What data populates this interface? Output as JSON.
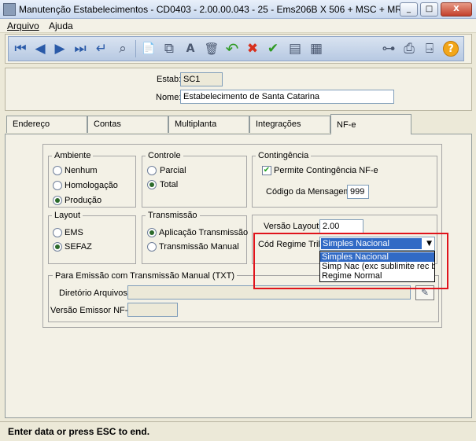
{
  "window": {
    "title": "Manutenção Estabelecimentos - CD0403 - 2.00.00.043 - 25 - Ems206B X 506 + MSC + MRI +",
    "minimize": "_",
    "maximize": "□",
    "close": "X"
  },
  "menu": {
    "arquivo": "Arquivo",
    "ajuda": "Ajuda"
  },
  "toolbar": {
    "first": "⏮",
    "prev": "◀",
    "next": "▶",
    "last": "⏭",
    "goto": "↵",
    "search": "⌕",
    "new": "📄",
    "copy": "⧉",
    "edit": "A",
    "delete": "🗑",
    "undo": "↶",
    "cancel": "✖",
    "save": "✔",
    "list": "▤",
    "report": "▦",
    "tree": "⊶",
    "print": "⎙",
    "exit": "⍈",
    "help": "?"
  },
  "header": {
    "estab_label": "Estab:",
    "estab_value": "SC1",
    "nome_label": "Nome:",
    "nome_value": "Estabelecimento de Santa Catarina"
  },
  "tabs": [
    "Endereço",
    "Contas",
    "Multiplanta",
    "Integrações",
    "NF-e"
  ],
  "ambiente": {
    "title": "Ambiente",
    "options": [
      "Nenhum",
      "Homologação",
      "Produção"
    ],
    "selected": "Produção"
  },
  "controle": {
    "title": "Controle",
    "options": [
      "Parcial",
      "Total"
    ],
    "selected": "Total"
  },
  "contingencia": {
    "title": "Contingência",
    "permite_label": "Permite Contingência NF-e",
    "permite_checked": true,
    "codigo_label": "Código da Mensagem:",
    "codigo_value": "999"
  },
  "layout": {
    "title": "Layout",
    "options": [
      "EMS",
      "SEFAZ"
    ],
    "selected": "SEFAZ"
  },
  "transmissao": {
    "title": "Transmissão",
    "options": [
      "Aplicação Transmissão",
      "Transmissão Manual"
    ],
    "selected": "Aplicação Transmissão"
  },
  "versao": {
    "layout_label": "Versão Layout:",
    "layout_value": "2.00",
    "regime_label": "Cód Regime Trib:",
    "regime_value": "Simples Nacional",
    "regime_options": [
      "Simples Nacional",
      "Simp Nac (exc sublimite rec brut",
      "Regime Normal"
    ]
  },
  "txt": {
    "title": "Para Emissão com Transmissão Manual (TXT)",
    "diretorio_label": "Diretório Arquivos:",
    "diretorio_value": "",
    "versao_label": "Versão Emissor NF-e:",
    "versao_value": ""
  },
  "status": "Enter data or press ESC to end.",
  "colors": {
    "highlight": "#316ac5",
    "annotation": "#e0141c"
  }
}
